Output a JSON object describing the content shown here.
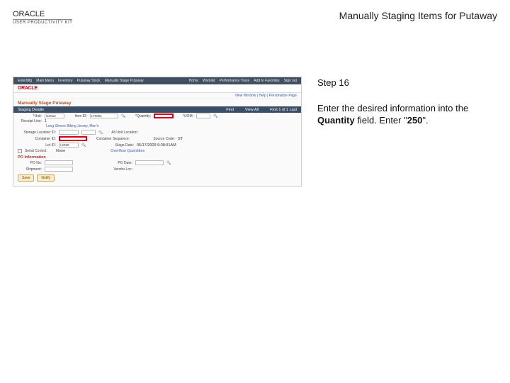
{
  "header": {
    "brand": "ORACLE",
    "brand_sub": "USER PRODUCTIVITY KIT",
    "page_title": "Manually Staging Items for Putaway"
  },
  "instruction": {
    "step_label": "Step 16",
    "line1": "Enter the desired information into the ",
    "bold1": "Quantity",
    "line2": " field. Enter \"",
    "bold2": "250",
    "line3": "\"."
  },
  "screenshot": {
    "topnav_left": [
      "EnterMfg",
      "Main Menu",
      "Inventory",
      "Putaway Stock",
      "Manually Stage Putaway"
    ],
    "topnav_right": [
      "Home",
      "Worklist",
      "Performance Trace",
      "Add to Favorites",
      "Sign out"
    ],
    "brand": "ORACLE",
    "subnav": "New Window | Help | Personalize Page",
    "page_heading": "Manually Stage Putaway",
    "bar_labels": [
      "Staging Details",
      "Find",
      "View All",
      "First 1 of 1 Last"
    ],
    "row_unit": {
      "label_unit": "*Unit:",
      "val_unit": "US012",
      "label_item": "Item ID:",
      "val_item": "LT5001",
      "label_qty": "*Quantity:",
      "label_uom": "*UOM:"
    },
    "row_receipt": {
      "label": "Receipt Line:",
      "val": "1"
    },
    "lot_desc": "Long Sleeve Biking Jersey, Men's",
    "row_storloc": {
      "label1": "Storage Location ID:",
      "label2": "Alt Unit Location:"
    },
    "row_cont": {
      "label1": "Container ID:",
      "label2": "Container Sequence:",
      "label3": "Source Code:",
      "val3": "ST"
    },
    "row_lot": {
      "label1": "Lot ID:",
      "val1": "L2020",
      "label2": "Stage Date:",
      "val2": "06/17/2009   9:08:01AM"
    },
    "row_serial": {
      "label": "Serial Control:",
      "chk": "None",
      "label2": "Overflow Quantities"
    },
    "section_po": "PO Information",
    "row_po": {
      "label1": "PO No:",
      "label2": "PO Date:"
    },
    "row_ship": {
      "label1": "Shipment:",
      "label2": "Vendor Loc:"
    },
    "btn_save": "Save",
    "btn_notify": "Notify"
  }
}
